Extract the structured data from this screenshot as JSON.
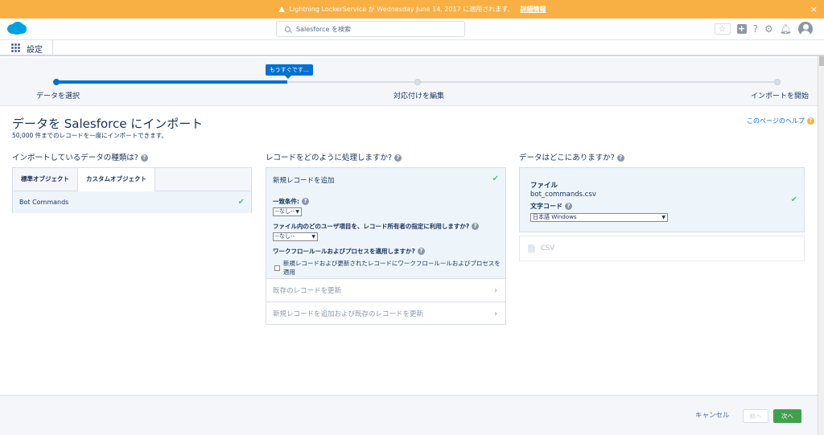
{
  "banner": {
    "message": "Lightning LockerService が Wednesday June 14, 2017 に適用されます。",
    "link": "詳細情報",
    "close": "×"
  },
  "header": {
    "search_placeholder": "Salesforce を検索",
    "help_glyph": "?"
  },
  "nav": {
    "title": "設定"
  },
  "progress": {
    "tooltip": "もうすぐです...",
    "steps": [
      {
        "label": "データを選択"
      },
      {
        "label": "対応付けを編集"
      },
      {
        "label": "インポートを開始"
      }
    ],
    "fraction_complete": 0.32
  },
  "page": {
    "title": "データを Salesforce にインポート",
    "subtitle": "50,000 件までのレコードを一度にインポートできます。",
    "help_link": "このページのヘルプ",
    "help_badge": "?"
  },
  "column1": {
    "heading": "インポートしているデータの種類は?",
    "tabs": [
      "標準オブジェクト",
      "カスタムオブジェクト"
    ],
    "selected_object": "Bot Commands"
  },
  "column2": {
    "heading": "レコードをどのように処理しますか?",
    "options": [
      {
        "label": "新規レコードを追加"
      },
      {
        "label": "既存のレコードを更新"
      },
      {
        "label": "新規レコードを追加および既存のレコードを更新"
      }
    ],
    "match_label": "一致条件:",
    "match_value": "--なし--",
    "owner_label": "ファイル内のどのユーザ項目を、レコード所有者の指定に利用しますか?",
    "owner_value": "--なし--",
    "workflow_label": "ワークフロールールおよびプロセスを適用しますか?",
    "workflow_checkbox": "新規レコードおよび更新されたレコードにワークフロールールおよびプロセスを適用"
  },
  "column3": {
    "heading": "データはどこにありますか?",
    "file_label": "ファイル",
    "file_name": "bot_commands.csv",
    "encoding_label": "文字コード",
    "encoding_value": "日本語 Windows",
    "csv_label": "CSV"
  },
  "footer": {
    "cancel": "キャンセル",
    "back": "前へ",
    "next": "次へ"
  },
  "colors": {
    "banner": "#f8b044",
    "brand_blue": "#0070d2",
    "success_green": "#3fa14d",
    "selected_bg": "#eef5fa"
  }
}
